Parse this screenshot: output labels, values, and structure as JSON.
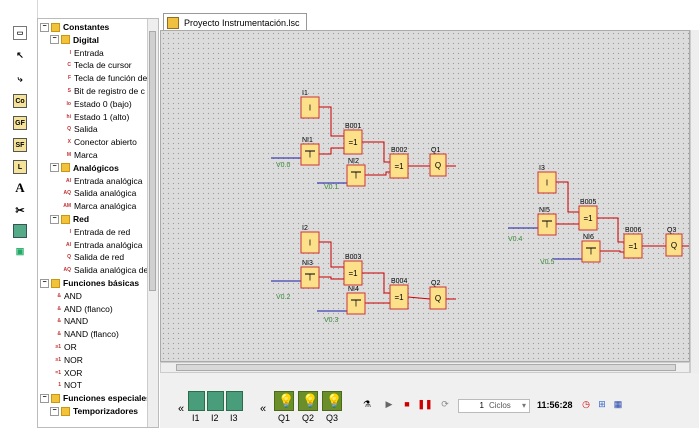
{
  "window": {
    "tab_title": "Proyecto Instrumentación.lsc"
  },
  "left_toolbar": {
    "icons": [
      "window-icon",
      "pointer-icon",
      "connector-icon",
      "constants-icon",
      "gf-icon",
      "sf-icon",
      "l-icon",
      "text-icon",
      "cut-icon",
      "block-icon",
      "network-icon"
    ],
    "co_label": "Co",
    "gf_label": "GF",
    "sf_label": "SF",
    "l_label": "L",
    "a_label": "A"
  },
  "tree": {
    "items": [
      {
        "label": "Constantes",
        "level": 0,
        "bold": true
      },
      {
        "label": "Digital",
        "level": 1,
        "bold": true
      },
      {
        "label": "Entrada",
        "level": 2,
        "mini": "I"
      },
      {
        "label": "Tecla de cursor",
        "level": 2,
        "mini": "C"
      },
      {
        "label": "Tecla de función de",
        "level": 2,
        "mini": "F"
      },
      {
        "label": "Bit de registro de c",
        "level": 2,
        "mini": "S"
      },
      {
        "label": "Estado 0 (bajo)",
        "level": 2,
        "mini": "lo"
      },
      {
        "label": "Estado 1 (alto)",
        "level": 2,
        "mini": "hi"
      },
      {
        "label": "Salida",
        "level": 2,
        "mini": "Q"
      },
      {
        "label": "Conector abierto",
        "level": 2,
        "mini": "X"
      },
      {
        "label": "Marca",
        "level": 2,
        "mini": "M"
      },
      {
        "label": "Analógicos",
        "level": 1,
        "bold": true
      },
      {
        "label": "Entrada analógica",
        "level": 2,
        "mini": "AI"
      },
      {
        "label": "Salida analógica",
        "level": 2,
        "mini": "AQ"
      },
      {
        "label": "Marca analógica",
        "level": 2,
        "mini": "AM"
      },
      {
        "label": "Red",
        "level": 1,
        "bold": true
      },
      {
        "label": "Entrada de red",
        "level": 2,
        "mini": "I"
      },
      {
        "label": "Entrada analógica",
        "level": 2,
        "mini": "AI"
      },
      {
        "label": "Salida de red",
        "level": 2,
        "mini": "Q"
      },
      {
        "label": "Salida analógica de",
        "level": 2,
        "mini": "AQ"
      },
      {
        "label": "Funciones básicas",
        "level": 0,
        "bold": true
      },
      {
        "label": "AND",
        "level": 1,
        "mini": "&"
      },
      {
        "label": "AND (flanco)",
        "level": 1,
        "mini": "&"
      },
      {
        "label": "NAND",
        "level": 1,
        "mini": "&"
      },
      {
        "label": "NAND (flanco)",
        "level": 1,
        "mini": "&"
      },
      {
        "label": "OR",
        "level": 1,
        "mini": "≥1"
      },
      {
        "label": "NOR",
        "level": 1,
        "mini": "≥1"
      },
      {
        "label": "XOR",
        "level": 1,
        "mini": "=1"
      },
      {
        "label": "NOT",
        "level": 1,
        "mini": "1"
      },
      {
        "label": "Funciones especiales",
        "level": 0,
        "bold": true
      },
      {
        "label": "Temporizadores",
        "level": 1,
        "bold": true
      }
    ]
  },
  "diagram": {
    "blocks": [
      {
        "id": "I1",
        "type": "I",
        "label": "I1",
        "label_pos": "above"
      },
      {
        "id": "NI1",
        "type": "NI",
        "label": "NI1",
        "label_pos": "above"
      },
      {
        "id": "B001",
        "type": "=1",
        "label": "B001",
        "label_pos": "above"
      },
      {
        "id": "NI2",
        "type": "NI",
        "label": "NI2",
        "label_pos": "above"
      },
      {
        "id": "B002",
        "type": "=1",
        "label": "B002",
        "label_pos": "above"
      },
      {
        "id": "Q1",
        "type": "Q",
        "label": "Q1",
        "label_pos": "above"
      },
      {
        "id": "I2",
        "type": "I",
        "label": "I2",
        "label_pos": "above"
      },
      {
        "id": "NI3",
        "type": "NI",
        "label": "NI3",
        "label_pos": "above"
      },
      {
        "id": "B003",
        "type": "=1",
        "label": "B003",
        "label_pos": "above"
      },
      {
        "id": "NI4",
        "type": "NI",
        "label": "NI4",
        "label_pos": "above"
      },
      {
        "id": "B004",
        "type": "=1",
        "label": "B004",
        "label_pos": "above"
      },
      {
        "id": "Q2",
        "type": "Q",
        "label": "Q2",
        "label_pos": "above"
      },
      {
        "id": "I3",
        "type": "I",
        "label": "I3",
        "label_pos": "above"
      },
      {
        "id": "NI5",
        "type": "NI",
        "label": "NI5",
        "label_pos": "above"
      },
      {
        "id": "B005",
        "type": "=1",
        "label": "B005",
        "label_pos": "above"
      },
      {
        "id": "NI6",
        "type": "NI",
        "label": "NI6",
        "label_pos": "above"
      },
      {
        "id": "B006",
        "type": "=1",
        "label": "B006",
        "label_pos": "above"
      },
      {
        "id": "Q3",
        "type": "Q",
        "label": "Q3",
        "label_pos": "above"
      }
    ],
    "net_labels": [
      "V0.0",
      "V0.1",
      "V0.2",
      "V0.3",
      "V0.4",
      "V0.5"
    ],
    "colors": {
      "block_fill": "#fce08a",
      "block_border": "#cc3333",
      "wire_red": "#cc0000",
      "wire_blue": "#1a1aa8",
      "label_green": "#3a8a3a"
    }
  },
  "bottom_bar": {
    "inputs": [
      "I1",
      "I2",
      "I3"
    ],
    "outputs": [
      "Q1",
      "Q2",
      "Q3"
    ],
    "cycles_value": "1",
    "cycles_unit": "Ciclos",
    "time": "11:56:28",
    "collapse_glyph": "«"
  }
}
